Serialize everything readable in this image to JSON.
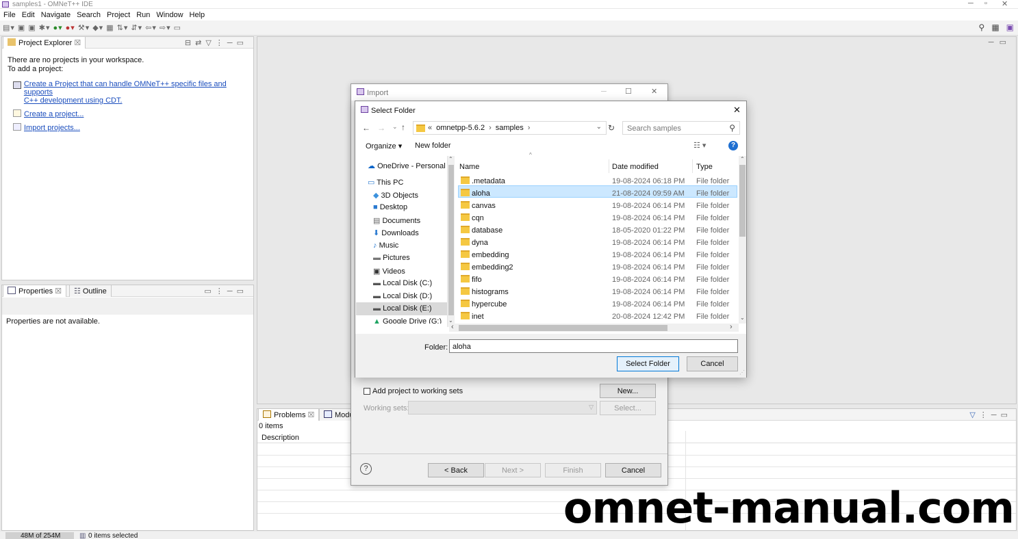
{
  "window": {
    "title": "samples1 - OMNeT++ IDE"
  },
  "menu": [
    "File",
    "Edit",
    "Navigate",
    "Search",
    "Project",
    "Run",
    "Window",
    "Help"
  ],
  "project_explorer": {
    "tab": "Project Explorer",
    "empty_line1": "There are no projects in your workspace.",
    "empty_line2": "To add a project:",
    "links": [
      "Create a Project that can handle OMNeT++ specific files and supports",
      "C++ development using CDT.",
      "Create a project...",
      "Import projects..."
    ]
  },
  "properties": {
    "tab": "Properties",
    "outline_tab": "Outline",
    "message": "Properties are not available."
  },
  "problems": {
    "tab": "Problems",
    "module_tab": "Modu",
    "count": "0 items",
    "col_description": "Description"
  },
  "status_bar": {
    "memory": "48M of 254M",
    "selection": "0 items selected"
  },
  "import_dialog": {
    "title": "Import",
    "add_working_sets": "Add project to working sets",
    "new_button": "New...",
    "working_sets_label": "Working sets:",
    "select_button": "Select...",
    "back": "< Back",
    "next": "Next >",
    "finish": "Finish",
    "cancel": "Cancel"
  },
  "select_folder": {
    "title": "Select Folder",
    "breadcrumb": [
      "omnetpp-5.6.2",
      "samples"
    ],
    "breadcrumb_prefix": "«",
    "search_placeholder": "Search samples",
    "organize": "Organize ▾",
    "new_folder": "New folder",
    "nav": [
      {
        "label": "OneDrive - Personal",
        "icon": "cloud-icon"
      },
      {
        "label": "This PC",
        "icon": "pc-icon"
      },
      {
        "label": "3D Objects",
        "icon": "cube-icon"
      },
      {
        "label": "Desktop",
        "icon": "desktop-icon"
      },
      {
        "label": "Documents",
        "icon": "document-icon"
      },
      {
        "label": "Downloads",
        "icon": "download-icon"
      },
      {
        "label": "Music",
        "icon": "music-icon"
      },
      {
        "label": "Pictures",
        "icon": "picture-icon"
      },
      {
        "label": "Videos",
        "icon": "video-icon"
      },
      {
        "label": "Local Disk (C:)",
        "icon": "disk-icon"
      },
      {
        "label": "Local Disk (D:)",
        "icon": "disk-icon"
      },
      {
        "label": "Local Disk (E:)",
        "icon": "disk-icon"
      },
      {
        "label": "Google Drive (G:)",
        "icon": "gdrive-icon"
      }
    ],
    "columns": {
      "name": "Name",
      "date": "Date modified",
      "type": "Type"
    },
    "files": [
      {
        "name": ".metadata",
        "date": "19-08-2024 06:18 PM",
        "type": "File folder"
      },
      {
        "name": "aloha",
        "date": "21-08-2024 09:59 AM",
        "type": "File folder"
      },
      {
        "name": "canvas",
        "date": "19-08-2024 06:14 PM",
        "type": "File folder"
      },
      {
        "name": "cqn",
        "date": "19-08-2024 06:14 PM",
        "type": "File folder"
      },
      {
        "name": "database",
        "date": "18-05-2020 01:22 PM",
        "type": "File folder"
      },
      {
        "name": "dyna",
        "date": "19-08-2024 06:14 PM",
        "type": "File folder"
      },
      {
        "name": "embedding",
        "date": "19-08-2024 06:14 PM",
        "type": "File folder"
      },
      {
        "name": "embedding2",
        "date": "19-08-2024 06:14 PM",
        "type": "File folder"
      },
      {
        "name": "fifo",
        "date": "19-08-2024 06:14 PM",
        "type": "File folder"
      },
      {
        "name": "histograms",
        "date": "19-08-2024 06:14 PM",
        "type": "File folder"
      },
      {
        "name": "hypercube",
        "date": "19-08-2024 06:14 PM",
        "type": "File folder"
      },
      {
        "name": "inet",
        "date": "20-08-2024 12:42 PM",
        "type": "File folder"
      }
    ],
    "folder_label": "Folder:",
    "folder_value": "aloha",
    "select_button": "Select Folder",
    "cancel_button": "Cancel"
  },
  "watermark": "omnet-manual.com",
  "colors": {
    "selection": "#cce8ff",
    "link": "#1a4dbd",
    "accent": "#0078d7"
  }
}
